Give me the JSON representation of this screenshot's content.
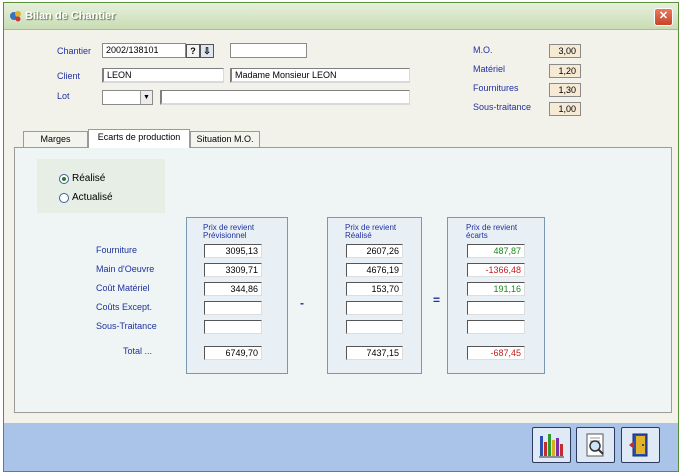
{
  "window": {
    "title": "Bilan de Chantier",
    "close_label": "✕"
  },
  "header": {
    "chantier_label": "Chantier",
    "chantier_value": "2002/138101",
    "help_label": "?",
    "down_label": "⇩",
    "chantier_extra_value": "",
    "client_label": "Client",
    "client_code": "LEON",
    "client_name": "Madame Monsieur LEON",
    "lot_label": "Lot",
    "lot_value": "",
    "lot_arrow": "▼",
    "lot_desc": ""
  },
  "coefficients": [
    {
      "label": "M.O.",
      "value": "3,00"
    },
    {
      "label": "Matériel",
      "value": "1,20"
    },
    {
      "label": "Fournitures",
      "value": "1,30"
    },
    {
      "label": "Sous-traitance",
      "value": "1,00"
    }
  ],
  "tabs": [
    {
      "label": "Marges",
      "active": false
    },
    {
      "label": "Ecarts de production",
      "active": true
    },
    {
      "label": "Situation M.O.",
      "active": false
    }
  ],
  "options": {
    "realise_label": "Réalisé",
    "actualise_label": "Actualisé",
    "selected": "Réalisé"
  },
  "rows": [
    "Fourniture",
    "Main d'Oeuvre",
    "Coût Matériel",
    "Coûts Except.",
    "Sous-Traitance"
  ],
  "total_label": "Total ...",
  "groups": [
    {
      "head1": "Prix de revient",
      "head2": "Prévisionnel",
      "values": [
        "3095,13",
        "3309,71",
        "344,86",
        "",
        ""
      ],
      "total": "6749,70"
    },
    {
      "head1": "Prix de revient",
      "head2": "Réalisé",
      "values": [
        "2607,26",
        "4676,19",
        "153,70",
        "",
        ""
      ],
      "total": "7437,15"
    },
    {
      "head1": "Prix de revient",
      "head2": "écarts",
      "values": [
        "487,87",
        "-1366,48",
        "191,16",
        "",
        ""
      ],
      "total": "-687,45"
    }
  ],
  "operators": {
    "minus": "-",
    "equals": "="
  },
  "colors": {
    "positive": "#1b8a1b",
    "negative": "#c81c1c",
    "label_blue": "#1f31a0",
    "footer": "#a9c4e8"
  },
  "footer_buttons": [
    {
      "name": "chart-button",
      "icon": "bar-chart-icon"
    },
    {
      "name": "preview-button",
      "icon": "print-preview-icon"
    },
    {
      "name": "exit-button",
      "icon": "exit-door-icon"
    }
  ]
}
